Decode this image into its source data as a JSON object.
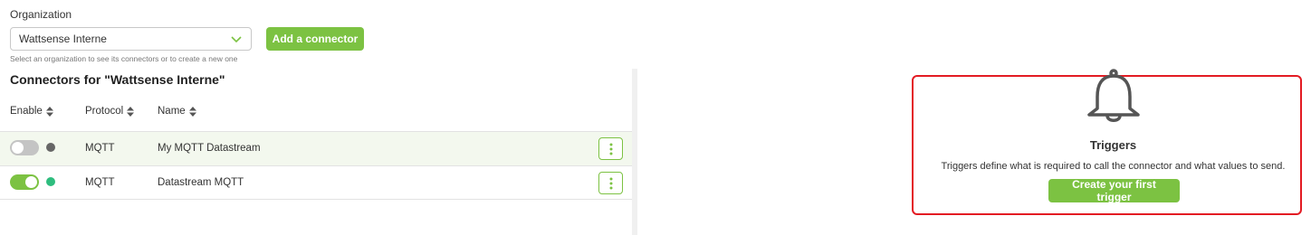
{
  "organization": {
    "label": "Organization",
    "selected": "Wattsense Interne",
    "helper": "Select an organization to see its connectors or to create a new one",
    "add_button": "Add a connector"
  },
  "connectors": {
    "title": "Connectors for \"Wattsense Interne\"",
    "columns": [
      "Enable",
      "Protocol",
      "Name"
    ],
    "rows": [
      {
        "enabled": false,
        "status_color": "#666666",
        "protocol": "MQTT",
        "name": "My MQTT Datastream"
      },
      {
        "enabled": true,
        "status_color": "#2ebd7e",
        "protocol": "MQTT",
        "name": "Datastream MQTT"
      }
    ]
  },
  "triggers": {
    "icon": "bell-icon",
    "title": "Triggers",
    "description": "Triggers define what is required to call the connector and what values to send.",
    "button": "Create your first trigger"
  },
  "colors": {
    "accent": "#7cc242",
    "highlight_border": "#e31b23",
    "row_selected_bg": "#f3f8ee"
  }
}
